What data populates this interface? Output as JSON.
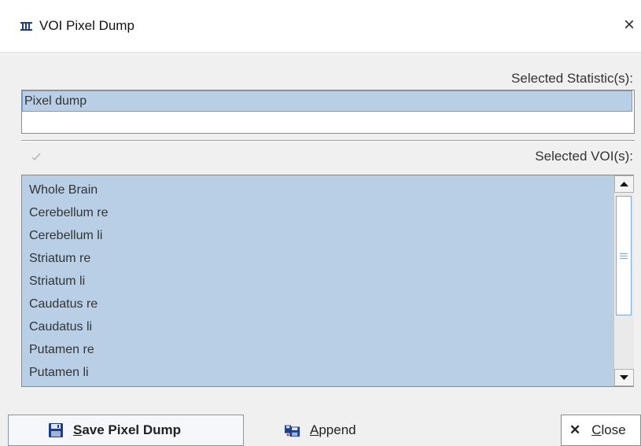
{
  "window": {
    "title": "VOI Pixel Dump",
    "close_glyph": "×"
  },
  "statistics": {
    "label": "Selected Statistic(s):",
    "items": [
      "Pixel dump"
    ]
  },
  "vois": {
    "label": "Selected VOI(s):",
    "check_glyph": "✓",
    "items": [
      "Whole Brain",
      "Cerebellum re",
      "Cerebellum li",
      "Striatum re",
      "Striatum li",
      "Caudatus re",
      "Caudatus li",
      "Putamen re",
      "Putamen li"
    ]
  },
  "buttons": {
    "save": {
      "first": "S",
      "rest": "ave Pixel Dump",
      "icon": "floppy-disk-icon"
    },
    "append": {
      "first": "A",
      "rest": "ppend",
      "icon": "append-disk-icon"
    },
    "close": {
      "first": "C",
      "rest": "lose",
      "icon": "close-x-icon",
      "glyph": "✕"
    }
  },
  "colors": {
    "selection": "#b9cfe6",
    "selection_border": "#6f9cd1"
  }
}
